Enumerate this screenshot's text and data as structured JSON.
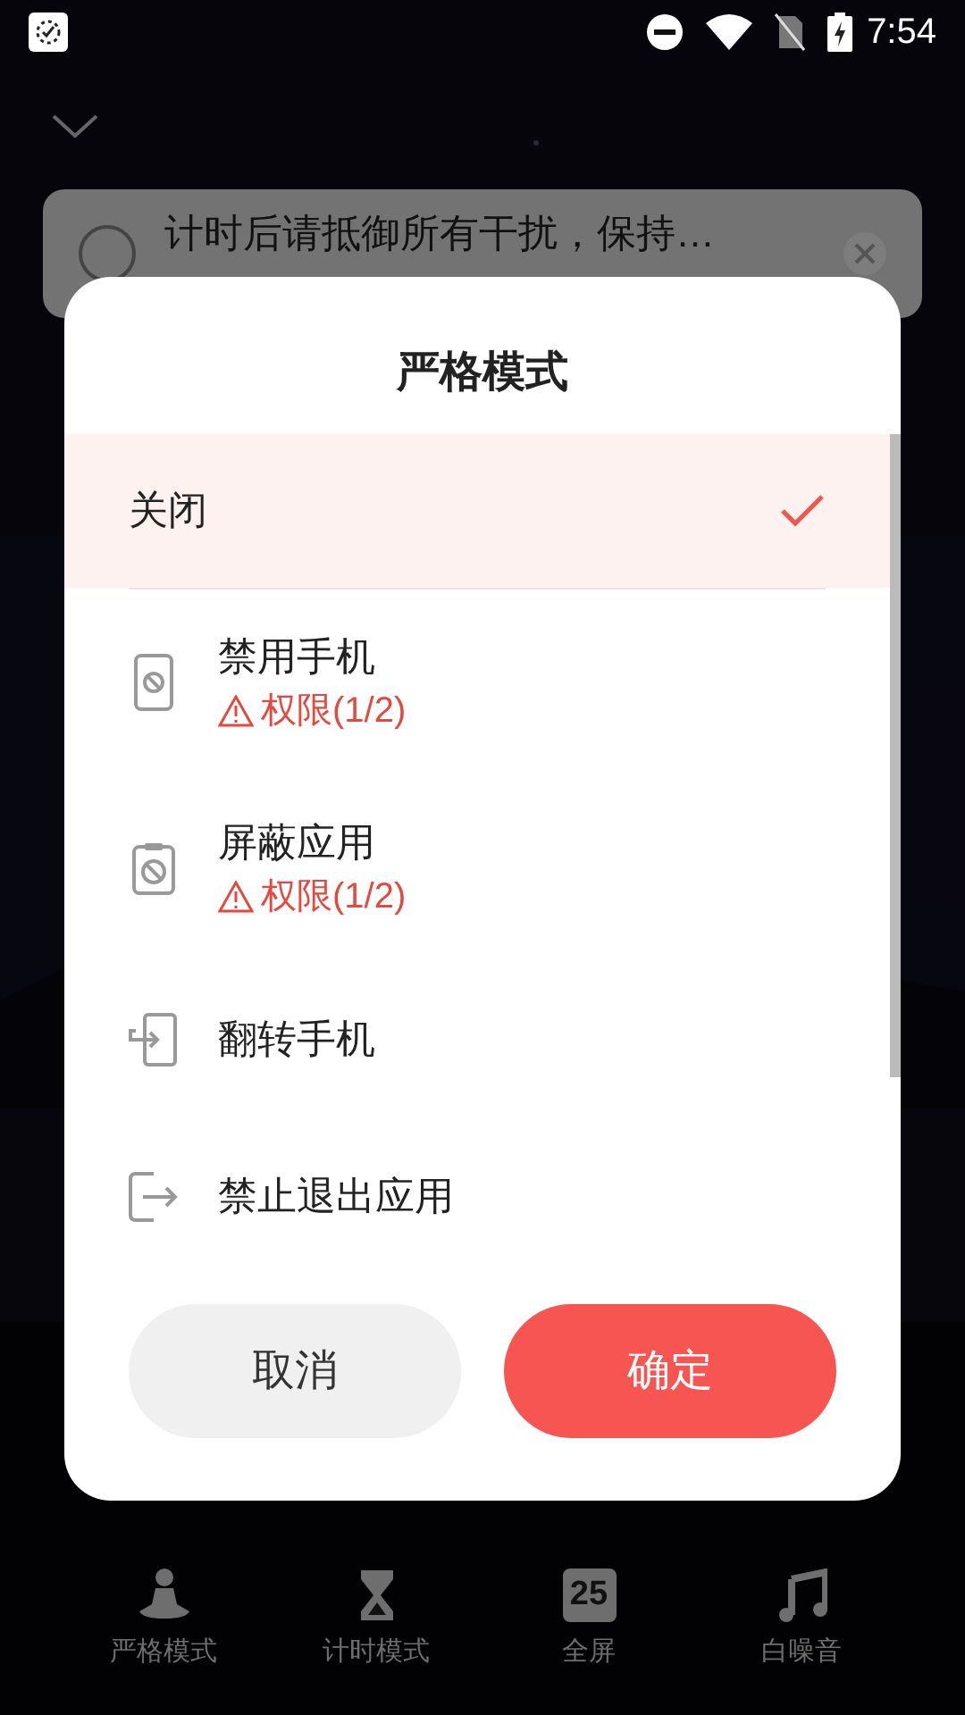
{
  "status_bar": {
    "time": "7:54"
  },
  "task_card": {
    "text": "计时后请抵御所有干扰，保持…",
    "checked": false
  },
  "dialog": {
    "title": "严格模式",
    "options": [
      {
        "kind": "plain",
        "label": "关闭",
        "selected": true
      },
      {
        "kind": "phone",
        "label": "禁用手机",
        "warning": "权限(1/2)",
        "selected": false
      },
      {
        "kind": "clipboard",
        "label": "屏蔽应用",
        "warning": "权限(1/2)",
        "selected": false
      },
      {
        "kind": "flip",
        "label": "翻转手机",
        "selected": false
      },
      {
        "kind": "exit",
        "label": "禁止退出应用",
        "selected": false
      }
    ],
    "buttons": [
      {
        "kind": "cancel",
        "label": "取消"
      },
      {
        "kind": "confirm",
        "label": "确定"
      }
    ]
  },
  "bottom_nav": [
    {
      "kind": "meditate",
      "label": "严格模式"
    },
    {
      "kind": "hourglass",
      "label": "计时模式"
    },
    {
      "kind": "clock",
      "label": "全屏",
      "icon_text": "25"
    },
    {
      "kind": "music",
      "label": "白噪音"
    }
  ]
}
